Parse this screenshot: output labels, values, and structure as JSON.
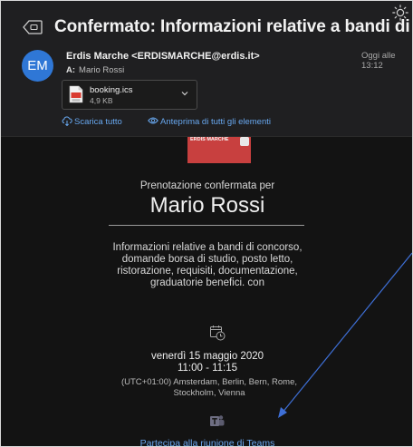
{
  "email": {
    "subject": "Confermato: Informazioni relative a bandi di concor...",
    "sender": "Erdis Marche <ERDISMARCHE@erdis.it>",
    "avatar_initials": "EM",
    "avatar_color": "#2f77d6",
    "date": "Oggi alle 13:12",
    "to_label": "A:",
    "to_name": "Mario Rossi",
    "attachment": {
      "name": "booking.ics",
      "size": "4,9 KB",
      "icon": "ics-file-icon"
    },
    "actions": {
      "download_all": "Scarica tutto",
      "preview_all": "Anteprima di tutti gli elementi"
    }
  },
  "message": {
    "logo_text": "ERDIS MARCHE",
    "confirmed_for": "Prenotazione confermata per",
    "attendee": "Mario Rossi",
    "description": "Informazioni relative a bandi di concorso, domande borsa di studio, posto letto, ristorazione, requisiti, documentazione, graduatorie benefici. con",
    "date": "venerdì 15 maggio 2020",
    "time": "11:00 - 11:15",
    "timezone": "(UTC+01:00) Amsterdam, Berlin, Bern, Rome, Stockholm, Vienna",
    "teams_link": "Partecipa alla riunione di Teams"
  },
  "colors": {
    "background": "#131313",
    "header": "#1f1f21",
    "link": "#6aa6ef",
    "logo": "#c8403f",
    "annotation_arrow": "#3e6fd6"
  }
}
